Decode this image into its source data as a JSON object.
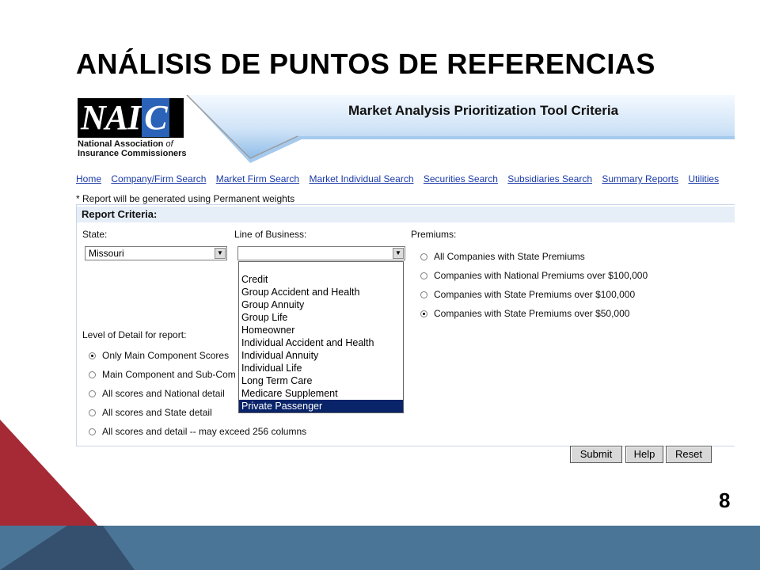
{
  "slide": {
    "title": "ANÁLISIS DE PUNTOS DE REFERENCIAS",
    "page_number": "8"
  },
  "banner": {
    "logo_text": "NAI",
    "logo_c": "C",
    "logo_sub_line1": "National Association",
    "logo_sub_of": "of",
    "logo_sub_line2": "Insurance Commissioners",
    "title": "Market Analysis Prioritization Tool Criteria"
  },
  "nav": {
    "items": [
      "Home",
      "Company/Firm Search",
      "Market Firm Search",
      "Market Individual Search",
      "Securities Search",
      "Subsidiaries Search",
      "Summary Reports",
      "Utilities"
    ]
  },
  "note": "* Report will be generated using Permanent weights",
  "criteria": {
    "heading": "Report Criteria:",
    "state_label": "State:",
    "state_value": "Missouri",
    "lob_label": "Line of Business:",
    "lob_value": "",
    "lob_options": [
      "Credit",
      "Group Accident and Health",
      "Group Annuity",
      "Group Life",
      "Homeowner",
      "Individual Accident and Health",
      "Individual Annuity",
      "Individual Life",
      "Long Term Care",
      "Medicare Supplement",
      "Private Passenger"
    ],
    "lob_highlighted": "Private Passenger",
    "premiums_label": "Premiums:",
    "premiums_options": [
      "All Companies with State Premiums",
      "Companies with National Premiums over $100,000",
      "Companies with State Premiums over $100,000",
      "Companies with State Premiums over $50,000"
    ],
    "premiums_selected_index": 3,
    "detail_label": "Level of Detail for report:",
    "detail_options": [
      "Only Main Component Scores",
      "Main Component and Sub-Com",
      "All scores and National detail",
      "All scores and State detail",
      "All scores and detail -- may exceed 256 columns"
    ],
    "detail_selected_index": 0
  },
  "buttons": {
    "submit": "Submit",
    "help": "Help",
    "reset": "Reset"
  },
  "colors": {
    "footer": "#4a7596",
    "corner_red": "#a52a36",
    "corner_navy": "#34506e",
    "banner_blue": "#7fb3e6"
  }
}
